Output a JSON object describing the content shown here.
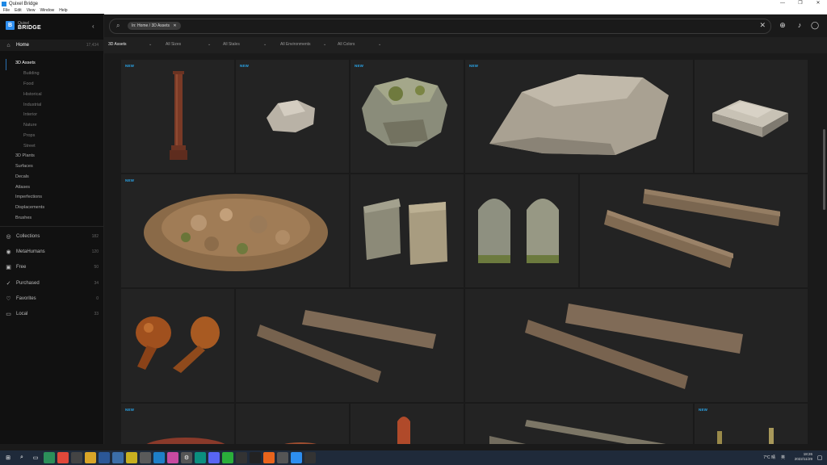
{
  "window": {
    "title": "Quixel Bridge",
    "controls": [
      "—",
      "❐",
      "✕"
    ]
  },
  "menu": [
    "File",
    "Edit",
    "View",
    "Window",
    "Help"
  ],
  "logo": {
    "top": "Quixel",
    "bottom": "BRIDGE"
  },
  "sidebar": {
    "home": {
      "label": "Home",
      "count": "17,434"
    },
    "assets_3d": "3D Assets",
    "sub_items": [
      "Building",
      "Food",
      "Historical",
      "Industrial",
      "Interior",
      "Nature",
      "Props",
      "Street"
    ],
    "top_items": [
      "3D Plants",
      "Surfaces",
      "Decals",
      "Atlases",
      "Imperfections",
      "Displacements",
      "Brushes"
    ],
    "sections": [
      {
        "label": "Collections",
        "count": "182",
        "icon": "globe-icon"
      },
      {
        "label": "MetaHumans",
        "count": "120",
        "icon": "person-icon"
      },
      {
        "label": "Free",
        "count": "50",
        "icon": "gift-icon"
      },
      {
        "label": "Purchased",
        "count": "34",
        "icon": "check-icon"
      },
      {
        "label": "Favorites",
        "count": "0",
        "icon": "heart-icon"
      },
      {
        "label": "Local",
        "count": "33",
        "icon": "monitor-icon"
      }
    ]
  },
  "search": {
    "chip": "In: Home / 3D Assets",
    "chip_close": "✕",
    "clear": "✕"
  },
  "filters": [
    "3D Assets",
    "All Sizes",
    "All Stales",
    "All Environments",
    "All Colors"
  ],
  "badge_new": "NEW",
  "tiles": [
    {
      "name": "column",
      "new": true
    },
    {
      "name": "small-rock",
      "new": true
    },
    {
      "name": "mossy-boulder",
      "new": true
    },
    {
      "name": "large-flat-rock",
      "new": true
    },
    {
      "name": "stone-slab",
      "new": false
    },
    {
      "name": "rubble-pile",
      "new": true
    },
    {
      "name": "gravestones-flat",
      "new": false
    },
    {
      "name": "gravestones-arched",
      "new": false
    },
    {
      "name": "wooden-beams",
      "new": false
    },
    {
      "name": "roast-chicken-legs",
      "new": false
    },
    {
      "name": "logs-pair-small",
      "new": false
    },
    {
      "name": "logs-pair-large",
      "new": false
    },
    {
      "name": "bread-loaf",
      "new": true
    },
    {
      "name": "bread-partial",
      "new": false
    },
    {
      "name": "sausage",
      "new": false
    },
    {
      "name": "planks",
      "new": false
    },
    {
      "name": "bamboo-plant",
      "new": true
    }
  ],
  "taskbar": {
    "lang": "英",
    "time": "18:26",
    "date": "2022/11/29",
    "weather": "7°C 晴"
  },
  "colors": {
    "accent": "#2d8ef0",
    "new_badge": "#2aa3e6",
    "background": "#1a1a1a",
    "tile": "#232323"
  }
}
